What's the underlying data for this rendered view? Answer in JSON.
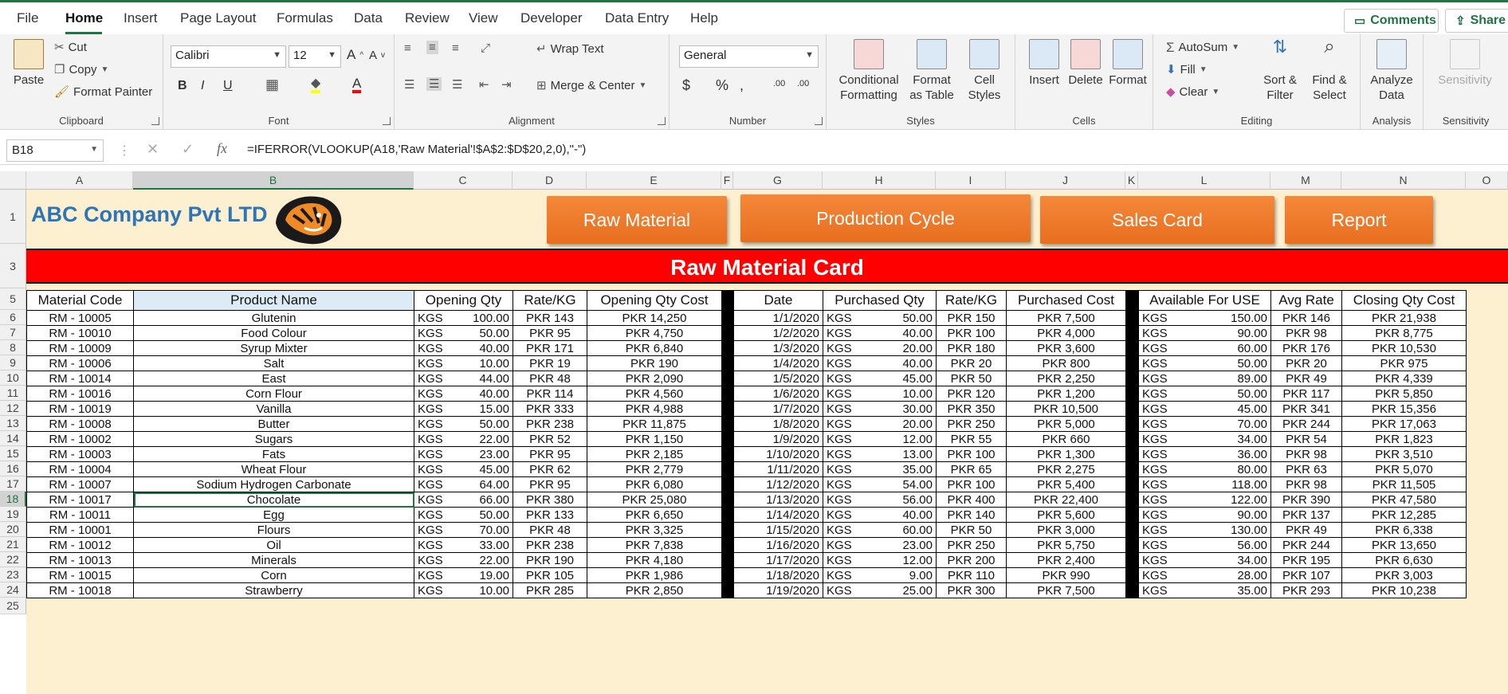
{
  "menu": {
    "tabs": [
      "File",
      "Home",
      "Insert",
      "Page Layout",
      "Formulas",
      "Data",
      "Review",
      "View",
      "Developer",
      "Data Entry",
      "Help"
    ],
    "comments_label": "Comments",
    "share_label": "Share"
  },
  "ribbon": {
    "clipboard": {
      "paste": "Paste",
      "cut": "Cut",
      "copy": "Copy",
      "format_painter": "Format Painter",
      "label": "Clipboard"
    },
    "font": {
      "name": "Calibri",
      "size": "12",
      "label": "Font"
    },
    "alignment": {
      "wrap_text": "Wrap Text",
      "merge_center": "Merge & Center",
      "label": "Alignment"
    },
    "number": {
      "format": "General",
      "label": "Number"
    },
    "styles": {
      "conditional": "Conditional Formatting",
      "format_table": "Format as Table",
      "cell_styles": "Cell Styles",
      "label": "Styles"
    },
    "cells": {
      "insert": "Insert",
      "delete": "Delete",
      "format": "Format",
      "label": "Cells"
    },
    "editing": {
      "autosum": "AutoSum",
      "fill": "Fill",
      "clear": "Clear",
      "sort_filter": "Sort & Filter",
      "find_select": "Find & Select",
      "label": "Editing"
    },
    "analysis": {
      "analyze": "Analyze Data",
      "label": "Analysis"
    },
    "sensitivity": {
      "button": "Sensitivity",
      "label": "Sensitivity"
    }
  },
  "formula_bar": {
    "name_box": "B18",
    "formula": "=IFERROR(VLOOKUP(A18,'Raw Material'!$A$2:$D$20,2,0),\"-\")"
  },
  "columns": [
    "A",
    "B",
    "C",
    "D",
    "E",
    "F",
    "G",
    "H",
    "I",
    "J",
    "K",
    "L",
    "M",
    "N",
    "O"
  ],
  "rows": [
    "1",
    "3",
    "5",
    "6",
    "7",
    "8",
    "9",
    "10",
    "11",
    "12",
    "13",
    "14",
    "15",
    "16",
    "17",
    "18",
    "19",
    "20",
    "21",
    "22",
    "23",
    "24",
    "25"
  ],
  "sheet": {
    "company": "ABC Company Pvt LTD",
    "buttons": [
      "Raw Material",
      "Production Cycle",
      "Sales Card",
      "Report"
    ],
    "banner": "Raw Material Card",
    "headers": [
      "Material Code",
      "Product Name",
      "Opening Qty",
      "Rate/KG",
      "Opening Qty Cost",
      "Date",
      "Purchased Qty",
      "Rate/KG",
      "Purchased Cost",
      "Available For USE",
      "Avg Rate",
      "Closing Qty Cost"
    ],
    "unit": "KGS",
    "rows": [
      [
        "RM - 10005",
        "Glutenin",
        "100.00",
        "PKR 143",
        "PKR 14,250",
        "1/1/2020",
        "50.00",
        "PKR 150",
        "PKR 7,500",
        "150.00",
        "PKR 146",
        "PKR 21,938"
      ],
      [
        "RM - 10010",
        "Food Colour",
        "50.00",
        "PKR 95",
        "PKR 4,750",
        "1/2/2020",
        "40.00",
        "PKR 100",
        "PKR 4,000",
        "90.00",
        "PKR 98",
        "PKR 8,775"
      ],
      [
        "RM - 10009",
        "Syrup Mixter",
        "40.00",
        "PKR 171",
        "PKR 6,840",
        "1/3/2020",
        "20.00",
        "PKR 180",
        "PKR 3,600",
        "60.00",
        "PKR 176",
        "PKR 10,530"
      ],
      [
        "RM - 10006",
        "Salt",
        "10.00",
        "PKR 19",
        "PKR 190",
        "1/4/2020",
        "40.00",
        "PKR 20",
        "PKR 800",
        "50.00",
        "PKR 20",
        "PKR 975"
      ],
      [
        "RM - 10014",
        "East",
        "44.00",
        "PKR 48",
        "PKR 2,090",
        "1/5/2020",
        "45.00",
        "PKR 50",
        "PKR 2,250",
        "89.00",
        "PKR 49",
        "PKR 4,339"
      ],
      [
        "RM - 10016",
        "Corn Flour",
        "40.00",
        "PKR 114",
        "PKR 4,560",
        "1/6/2020",
        "10.00",
        "PKR 120",
        "PKR 1,200",
        "50.00",
        "PKR 117",
        "PKR 5,850"
      ],
      [
        "RM - 10019",
        "Vanilla",
        "15.00",
        "PKR 333",
        "PKR 4,988",
        "1/7/2020",
        "30.00",
        "PKR 350",
        "PKR 10,500",
        "45.00",
        "PKR 341",
        "PKR 15,356"
      ],
      [
        "RM - 10008",
        "Butter",
        "50.00",
        "PKR 238",
        "PKR 11,875",
        "1/8/2020",
        "20.00",
        "PKR 250",
        "PKR 5,000",
        "70.00",
        "PKR 244",
        "PKR 17,063"
      ],
      [
        "RM - 10002",
        "Sugars",
        "22.00",
        "PKR 52",
        "PKR 1,150",
        "1/9/2020",
        "12.00",
        "PKR 55",
        "PKR 660",
        "34.00",
        "PKR 54",
        "PKR 1,823"
      ],
      [
        "RM - 10003",
        "Fats",
        "23.00",
        "PKR 95",
        "PKR 2,185",
        "1/10/2020",
        "13.00",
        "PKR 100",
        "PKR 1,300",
        "36.00",
        "PKR 98",
        "PKR 3,510"
      ],
      [
        "RM - 10004",
        "Wheat Flour",
        "45.00",
        "PKR 62",
        "PKR 2,779",
        "1/11/2020",
        "35.00",
        "PKR 65",
        "PKR 2,275",
        "80.00",
        "PKR 63",
        "PKR 5,070"
      ],
      [
        "RM - 10007",
        "Sodium Hydrogen Carbonate",
        "64.00",
        "PKR 95",
        "PKR 6,080",
        "1/12/2020",
        "54.00",
        "PKR 100",
        "PKR 5,400",
        "118.00",
        "PKR 98",
        "PKR 11,505"
      ],
      [
        "RM - 10017",
        "Chocolate",
        "66.00",
        "PKR 380",
        "PKR 25,080",
        "1/13/2020",
        "56.00",
        "PKR 400",
        "PKR 22,400",
        "122.00",
        "PKR 390",
        "PKR 47,580"
      ],
      [
        "RM - 10011",
        "Egg",
        "50.00",
        "PKR 133",
        "PKR 6,650",
        "1/14/2020",
        "40.00",
        "PKR 140",
        "PKR 5,600",
        "90.00",
        "PKR 137",
        "PKR 12,285"
      ],
      [
        "RM - 10001",
        "Flours",
        "70.00",
        "PKR 48",
        "PKR 3,325",
        "1/15/2020",
        "60.00",
        "PKR 50",
        "PKR 3,000",
        "130.00",
        "PKR 49",
        "PKR 6,338"
      ],
      [
        "RM - 10012",
        "Oil",
        "33.00",
        "PKR 238",
        "PKR 7,838",
        "1/16/2020",
        "23.00",
        "PKR 250",
        "PKR 5,750",
        "56.00",
        "PKR 244",
        "PKR 13,650"
      ],
      [
        "RM - 10013",
        "Minerals",
        "22.00",
        "PKR 190",
        "PKR 4,180",
        "1/17/2020",
        "12.00",
        "PKR 200",
        "PKR 2,400",
        "34.00",
        "PKR 195",
        "PKR 6,630"
      ],
      [
        "RM - 10015",
        "Corn",
        "19.00",
        "PKR 105",
        "PKR 1,986",
        "1/18/2020",
        "9.00",
        "PKR 110",
        "PKR 990",
        "28.00",
        "PKR 107",
        "PKR 3,003"
      ],
      [
        "RM - 10018",
        "Strawberry",
        "10.00",
        "PKR 285",
        "PKR 2,850",
        "1/19/2020",
        "25.00",
        "PKR 300",
        "PKR 7,500",
        "35.00",
        "PKR 293",
        "PKR 10,238"
      ]
    ]
  },
  "colors": {
    "accent": "#217346",
    "title": "#2e75b6",
    "banner": "#ff0000",
    "button": "#f07b2c",
    "sheet_bg": "#fdf0d1"
  }
}
